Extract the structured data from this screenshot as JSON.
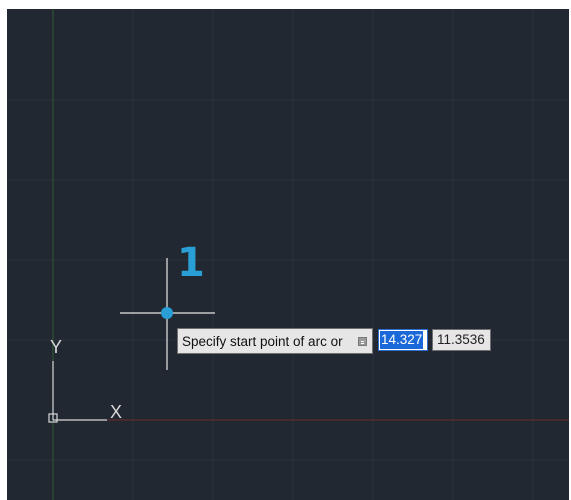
{
  "canvas": {
    "background": "#222831",
    "grid_color": "#2b323c",
    "x_axis_color": "#6b2b2b",
    "y_axis_color": "#2e5a34"
  },
  "ucs_icon": {
    "x_label": "X",
    "y_label": "Y",
    "color": "#d8d8d8"
  },
  "annotation": {
    "step_number": "1",
    "color": "#2a9fd6"
  },
  "dynamic_input": {
    "prompt": "Specify start point of arc or",
    "options_icon": "down-arrow-options-icon",
    "x_value": "14.327",
    "y_value": "11.3536",
    "selection_color": "#1b69d8"
  }
}
